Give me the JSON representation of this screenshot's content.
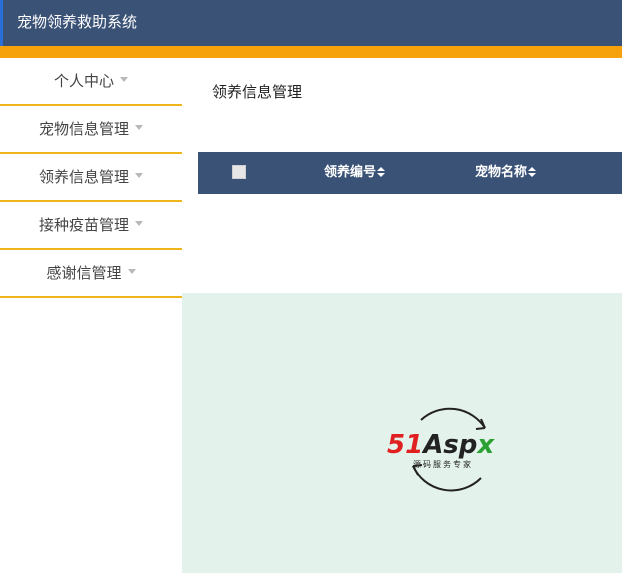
{
  "header": {
    "title": "宠物领养救助系统"
  },
  "sidebar": {
    "items": [
      {
        "label": "个人中心"
      },
      {
        "label": "宠物信息管理"
      },
      {
        "label": "领养信息管理"
      },
      {
        "label": "接种疫苗管理"
      },
      {
        "label": "感谢信管理"
      }
    ]
  },
  "main": {
    "page_title": "领养信息管理",
    "table": {
      "columns": [
        {
          "label": "领养编号"
        },
        {
          "label": "宠物名称"
        }
      ]
    }
  },
  "watermark": {
    "logo_51": "51",
    "logo_asp": "Asp",
    "logo_x": "x",
    "tagline": "源码服务专家"
  },
  "colors": {
    "header_bg": "#3b5277",
    "accent_stripe": "#f5a20c",
    "nav_divider": "#f0b51c",
    "watermark_bg": "#e4f2ec"
  }
}
